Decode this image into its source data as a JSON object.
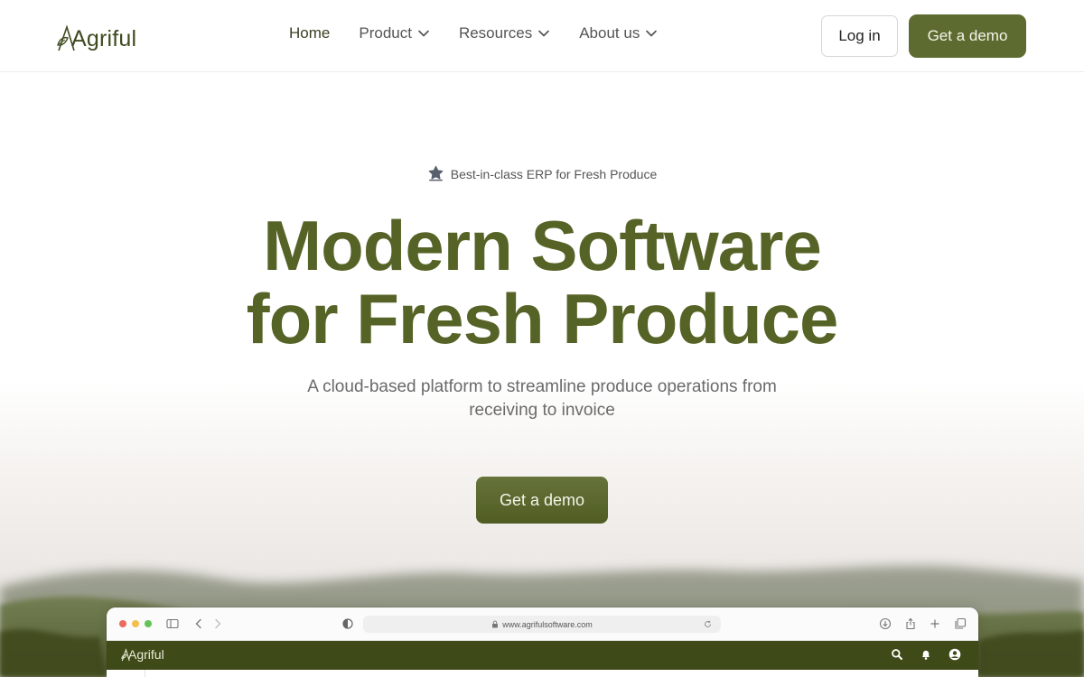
{
  "brand": {
    "name": "Agriful"
  },
  "nav": {
    "links": [
      {
        "label": "Home",
        "active": true
      },
      {
        "label": "Product",
        "dropdown": true
      },
      {
        "label": "Resources",
        "dropdown": true
      },
      {
        "label": "About us",
        "dropdown": true
      }
    ],
    "login_label": "Log in",
    "demo_label": "Get a demo"
  },
  "hero": {
    "badge": "Best-in-class ERP for Fresh Produce",
    "headline_line1": "Modern Software",
    "headline_line2": "for Fresh Produce",
    "subtitle": "A cloud-based platform to streamline produce operations from receiving to invoice",
    "cta_label": "Get a demo"
  },
  "browser_preview": {
    "url": "www.agrifulsoftware.com",
    "app_name": "Agriful",
    "toolbar_icons": [
      "sidebar-icon",
      "back-icon",
      "forward-icon",
      "shield-icon",
      "download-icon",
      "share-icon",
      "new-tab-icon",
      "tabs-icon"
    ],
    "app_icons": [
      "search-icon",
      "bell-icon",
      "user-icon"
    ]
  },
  "colors": {
    "brand_green": "#5d6a30",
    "headline_green": "#566326",
    "app_bar": "#3e4a18"
  }
}
